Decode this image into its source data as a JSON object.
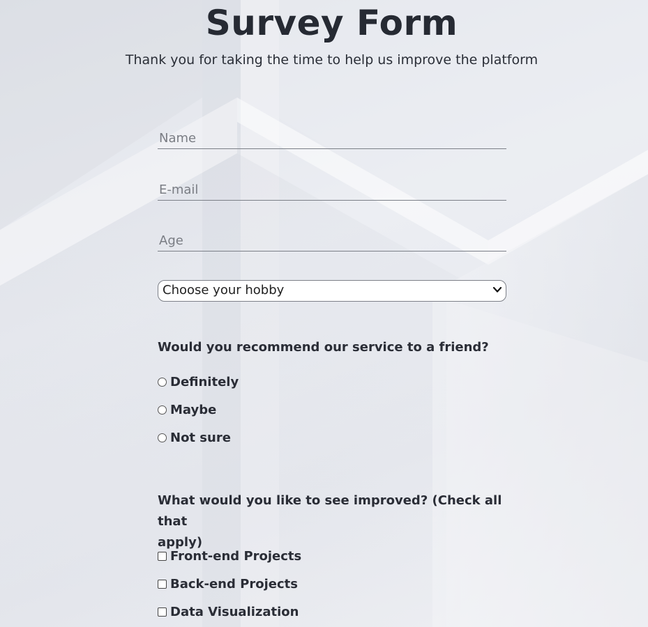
{
  "header": {
    "title": "Survey Form",
    "subtitle": "Thank you for taking the time to help us improve the platform"
  },
  "form": {
    "name_placeholder": "Name",
    "email_placeholder": "E-mail",
    "age_placeholder": "Age",
    "hobby_select": "Choose your hobby",
    "recommend_question": "Would you recommend our service to a friend?",
    "recommend_options": [
      "Definitely",
      "Maybe",
      "Not sure"
    ],
    "improve_question_line1": "What would you like to see improved? (Check all that",
    "improve_question_line2": "apply)",
    "improve_options": [
      "Front-end Projects",
      "Back-end Projects",
      "Data Visualization"
    ]
  },
  "icons": {
    "select_arrow": "chevron-down-icon"
  },
  "colors": {
    "text": "#23272f",
    "underline": "#7b7f87",
    "background": "#e9ebf0"
  }
}
